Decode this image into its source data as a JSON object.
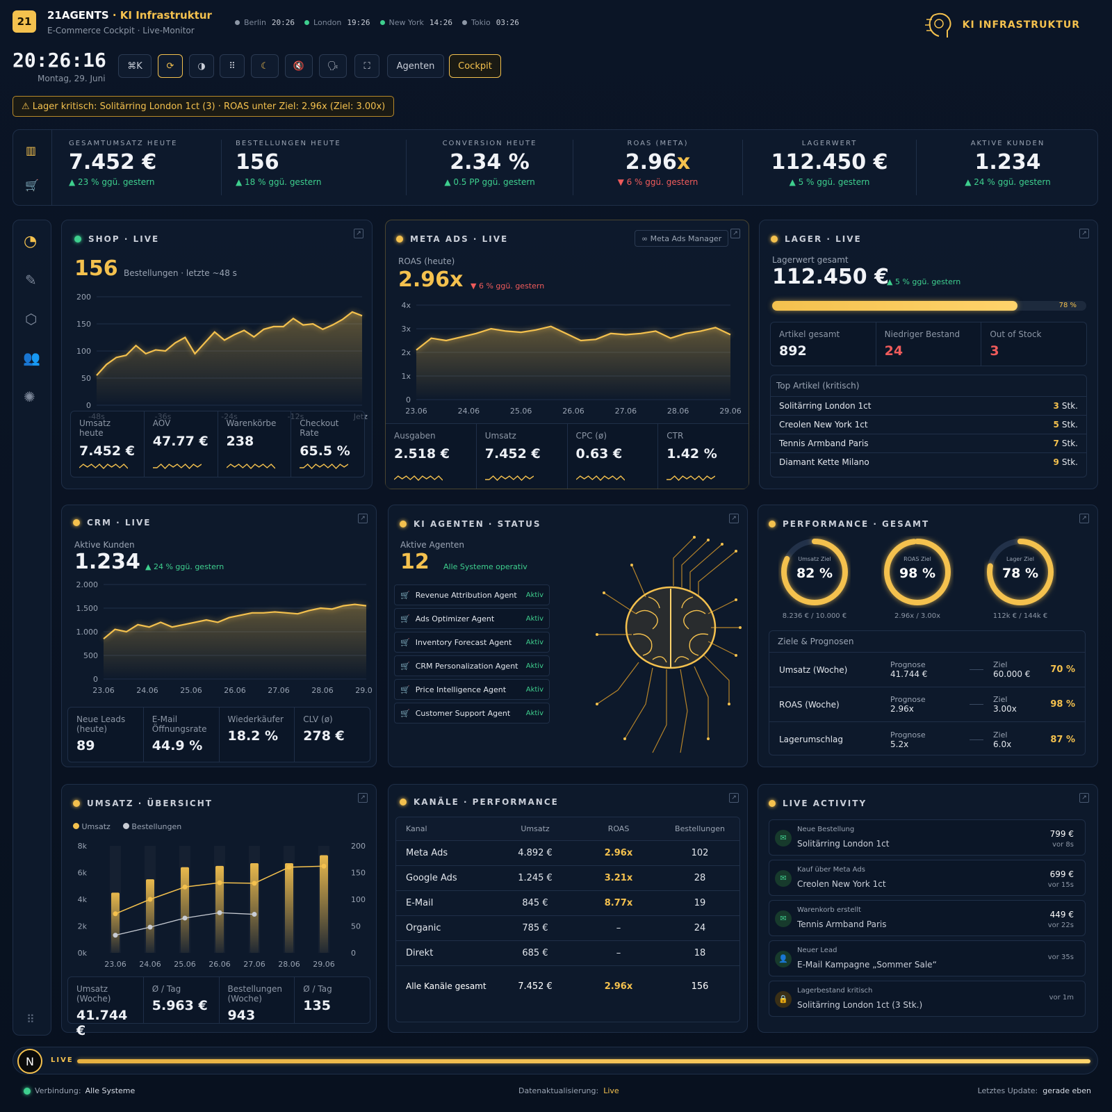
{
  "header": {
    "logo": "21",
    "brand": "21AGENTS",
    "brand_sep": " · ",
    "brand_sub": "KI Infrastruktur",
    "subtitle": "E-Commerce Cockpit · Live-Monitor",
    "right_brand": "KI INFRASTRUKTUR",
    "clocks": [
      {
        "city": "Berlin",
        "time": "20:26",
        "color": "#8d97a6"
      },
      {
        "city": "London",
        "time": "19:26",
        "color": "#3ecf8e"
      },
      {
        "city": "New York",
        "time": "14:26",
        "color": "#3ecf8e"
      },
      {
        "city": "Tokio",
        "time": "03:26",
        "color": "#8d97a6"
      }
    ]
  },
  "clock": {
    "time": "20:26:16",
    "date": "Montag, 29. Juni"
  },
  "toolbar": {
    "cmd": "⌘K",
    "agents": "Agenten",
    "cockpit": "Cockpit"
  },
  "alert": "⚠ Lager kritisch: Solitärring London 1ct (3) · ROAS unter Ziel: 2.96x (Ziel: 3.00x)",
  "kpis": [
    {
      "label": "GESAMTUMSATZ HEUTE",
      "value": "7.452 €",
      "delta": "▲ 23 % ggü. gestern",
      "dir": "up"
    },
    {
      "label": "BESTELLUNGEN HEUTE",
      "value": "156",
      "delta": "▲ 18 % ggü. gestern",
      "dir": "up"
    },
    {
      "label": "CONVERSION HEUTE",
      "value": "2.34 %",
      "delta": "▲ 0.5 PP ggü. gestern",
      "dir": "up"
    },
    {
      "label": "ROAS (META)",
      "value": "2.96",
      "value_suffix": "x",
      "delta": "▼ 6 % ggü. gestern",
      "dir": "down"
    },
    {
      "label": "LAGERWERT",
      "value": "112.450 €",
      "delta": "▲ 5 % ggü. gestern",
      "dir": "up"
    },
    {
      "label": "AKTIVE KUNDEN",
      "value": "1.234",
      "delta": "▲ 24 % ggü. gestern",
      "dir": "up"
    }
  ],
  "shop": {
    "title": "SHOP · LIVE",
    "big": "156",
    "note": "Bestellungen · letzte ~48 s",
    "chart": {
      "type": "area",
      "x_labels": [
        "-48s",
        "-36s",
        "-24s",
        "-12s",
        "Jetzt"
      ],
      "y_ticks": [
        "200",
        "150",
        "100",
        "50",
        "0"
      ],
      "ylim": [
        0,
        200
      ],
      "values": [
        55,
        75,
        88,
        92,
        110,
        95,
        102,
        100,
        115,
        125,
        95,
        115,
        135,
        120,
        130,
        138,
        126,
        140,
        145,
        145,
        160,
        148,
        150,
        140,
        148,
        158,
        172,
        165
      ]
    },
    "stats": [
      {
        "label": "Umsatz heute",
        "value": "7.452 €"
      },
      {
        "label": "AOV",
        "value": "47.77 €"
      },
      {
        "label": "Warenkörbe",
        "value": "238"
      },
      {
        "label": "Checkout Rate",
        "value": "65.5 %"
      }
    ]
  },
  "meta": {
    "title": "META ADS · LIVE",
    "manager": "∞  Meta Ads Manager",
    "label": "ROAS (heute)",
    "big": "2.96x",
    "delta": "▼ 6 % ggü. gestern",
    "chart": {
      "type": "area",
      "x_labels": [
        "23.06",
        "24.06",
        "25.06",
        "26.06",
        "27.06",
        "28.06",
        "29.06"
      ],
      "y_ticks": [
        "4x",
        "3x",
        "2x",
        "1x",
        "0"
      ],
      "ylim": [
        0,
        4
      ],
      "values": [
        2.1,
        2.6,
        2.5,
        2.65,
        2.8,
        3.0,
        2.9,
        2.85,
        2.95,
        3.1,
        2.8,
        2.5,
        2.55,
        2.8,
        2.75,
        2.8,
        2.9,
        2.6,
        2.8,
        2.9,
        3.05,
        2.75
      ]
    },
    "stats": [
      {
        "label": "Ausgaben",
        "value": "2.518 €"
      },
      {
        "label": "Umsatz",
        "value": "7.452 €"
      },
      {
        "label": "CPC (ø)",
        "value": "0.63 €"
      },
      {
        "label": "CTR",
        "value": "1.42 %"
      }
    ]
  },
  "lager": {
    "title": "LAGER · LIVE",
    "label": "Lagerwert gesamt",
    "big": "112.450 €",
    "delta": "▲ 5 % ggü. gestern",
    "progress": 0.78,
    "progress_label": "78 %",
    "stats": [
      {
        "label": "Artikel gesamt",
        "value": "892",
        "color": "#eef1f6"
      },
      {
        "label": "Niedriger Bestand",
        "value": "24",
        "color": "#ef5b5b"
      },
      {
        "label": "Out of Stock",
        "value": "3",
        "color": "#ef5b5b"
      }
    ],
    "top_title": "Top Artikel (kritisch)",
    "top": [
      {
        "name": "Solitärring London 1ct",
        "qty": "3",
        "unit": "Stk."
      },
      {
        "name": "Creolen New York 1ct",
        "qty": "5",
        "unit": "Stk."
      },
      {
        "name": "Tennis Armband Paris",
        "qty": "7",
        "unit": "Stk."
      },
      {
        "name": "Diamant Kette Milano",
        "qty": "9",
        "unit": "Stk."
      }
    ]
  },
  "crm": {
    "title": "CRM · LIVE",
    "label": "Aktive Kunden",
    "big": "1.234",
    "delta": "▲ 24 % ggü. gestern",
    "chart": {
      "type": "area",
      "x_labels": [
        "23.06",
        "24.06",
        "25.06",
        "26.06",
        "27.06",
        "28.06",
        "29.06"
      ],
      "y_ticks": [
        "2.000",
        "1.500",
        "1.000",
        "500",
        "0"
      ],
      "ylim": [
        0,
        2000
      ],
      "values": [
        850,
        1050,
        1000,
        1150,
        1100,
        1200,
        1100,
        1150,
        1200,
        1250,
        1200,
        1300,
        1350,
        1400,
        1400,
        1420,
        1400,
        1380,
        1450,
        1500,
        1480,
        1550,
        1580,
        1550
      ]
    },
    "stats": [
      {
        "label": "Neue Leads (heute)",
        "value": "89"
      },
      {
        "label": "E-Mail Öffnungsrate",
        "value": "44.9 %"
      },
      {
        "label": "Wiederkäufer",
        "value": "18.2 %"
      },
      {
        "label": "CLV (ø)",
        "value": "278 €"
      }
    ]
  },
  "agents": {
    "title": "KI AGENTEN · STATUS",
    "label": "Aktive Agenten",
    "big": "12",
    "status": "Alle Systeme operativ",
    "list": [
      {
        "name": "Revenue Attribution Agent",
        "state": "Aktiv"
      },
      {
        "name": "Ads Optimizer Agent",
        "state": "Aktiv"
      },
      {
        "name": "Inventory Forecast Agent",
        "state": "Aktiv"
      },
      {
        "name": "CRM Personalization Agent",
        "state": "Aktiv"
      },
      {
        "name": "Price Intelligence Agent",
        "state": "Aktiv"
      },
      {
        "name": "Customer Support Agent",
        "state": "Aktiv"
      }
    ]
  },
  "perf": {
    "title": "PERFORMANCE · GESAMT",
    "rings": [
      {
        "label": "Umsatz Ziel",
        "value": "82 %",
        "frac": 0.82,
        "sub": "8.236 € / 10.000 €"
      },
      {
        "label": "ROAS Ziel",
        "value": "98 %",
        "frac": 0.98,
        "sub": "2.96x / 3.00x"
      },
      {
        "label": "Lager Ziel",
        "value": "78 %",
        "frac": 0.78,
        "sub": "112k € / 144k €"
      }
    ],
    "goals_title": "Ziele & Prognosen",
    "goals": [
      {
        "name": "Umsatz (Woche)",
        "p_label": "Prognose",
        "p_value": "41.744 €",
        "z_label": "Ziel",
        "z_value": "60.000 €",
        "pct": "70 %"
      },
      {
        "name": "ROAS (Woche)",
        "p_label": "Prognose",
        "p_value": "2.96x",
        "z_label": "Ziel",
        "z_value": "3.00x",
        "pct": "98 %"
      },
      {
        "name": "Lagerumschlag",
        "p_label": "Prognose",
        "p_value": "5.2x",
        "z_label": "Ziel",
        "z_value": "6.0x",
        "pct": "87 %"
      }
    ]
  },
  "umsatz": {
    "title": "UMSATZ · ÜBERSICHT",
    "legend": [
      "Umsatz",
      "Bestellungen"
    ],
    "chart_data": {
      "type": "bar",
      "categories": [
        "23.06",
        "24.06",
        "25.06",
        "26.06",
        "27.06",
        "28.06",
        "29.06"
      ],
      "y_left": [
        "8k",
        "6k",
        "4k",
        "2k",
        "0k"
      ],
      "y_right": [
        "200",
        "150",
        "100",
        "50",
        "0"
      ],
      "ylim_left": [
        0,
        8000
      ],
      "ylim_right": [
        0,
        200
      ],
      "series": [
        {
          "name": "Umsatz",
          "values": [
            4500,
            5500,
            6400,
            6500,
            6700,
            6700,
            7300
          ]
        },
        {
          "name": "Bestellungen",
          "values": [
            73,
            100,
            123,
            131,
            130,
            160,
            162
          ]
        },
        {
          "values": [
            33,
            48,
            65,
            75,
            72
          ]
        }
      ]
    },
    "stats": [
      {
        "label": "Umsatz (Woche)",
        "value": "41.744 €"
      },
      {
        "label": "Ø / Tag",
        "value": "5.963 €"
      },
      {
        "label": "Bestellungen (Woche)",
        "value": "943"
      },
      {
        "label": "Ø / Tag",
        "value": "135"
      }
    ]
  },
  "kanaele": {
    "title": "KANÄLE · PERFORMANCE",
    "headers": [
      "Kanal",
      "Umsatz",
      "ROAS",
      "Bestellungen"
    ],
    "rows": [
      [
        "Meta Ads",
        "4.892 €",
        "2.96x",
        "102"
      ],
      [
        "Google Ads",
        "1.245 €",
        "3.21x",
        "28"
      ],
      [
        "E-Mail",
        "845 €",
        "8.77x",
        "19"
      ],
      [
        "Organic",
        "785 €",
        "–",
        "24"
      ],
      [
        "Direkt",
        "685 €",
        "–",
        "18"
      ]
    ],
    "total": [
      "Alle Kanäle gesamt",
      "7.452 €",
      "2.96x",
      "156"
    ]
  },
  "activity": {
    "title": "LIVE ACTIVITY",
    "items": [
      {
        "title": "Neue Bestellung",
        "desc": "Solitärring London 1ct",
        "amount": "799 €",
        "ago": "vor 8s",
        "icon": "✉"
      },
      {
        "title": "Kauf über Meta Ads",
        "desc": "Creolen New York 1ct",
        "amount": "699 €",
        "ago": "vor 15s",
        "icon": "✉"
      },
      {
        "title": "Warenkorb erstellt",
        "desc": "Tennis Armband Paris",
        "amount": "449 €",
        "ago": "vor 22s",
        "icon": "✉"
      },
      {
        "title": "Neuer Lead",
        "desc": "E-Mail Kampagne „Sommer Sale“",
        "amount": "",
        "ago": "vor 35s",
        "icon": "👤"
      },
      {
        "title": "Lagerbestand kritisch",
        "desc": "Solitärring London 1ct (3 Stk.)",
        "amount": "",
        "ago": "vor 1m",
        "icon": "🔒"
      }
    ]
  },
  "footer": {
    "live": "LIVE",
    "conn_label": "Verbindung:",
    "conn": "Alle Systeme",
    "refresh_label": "Datenaktualisierung:",
    "refresh": "Live",
    "update_label": "Letztes Update:",
    "update": "gerade eben",
    "avatar": "N"
  }
}
